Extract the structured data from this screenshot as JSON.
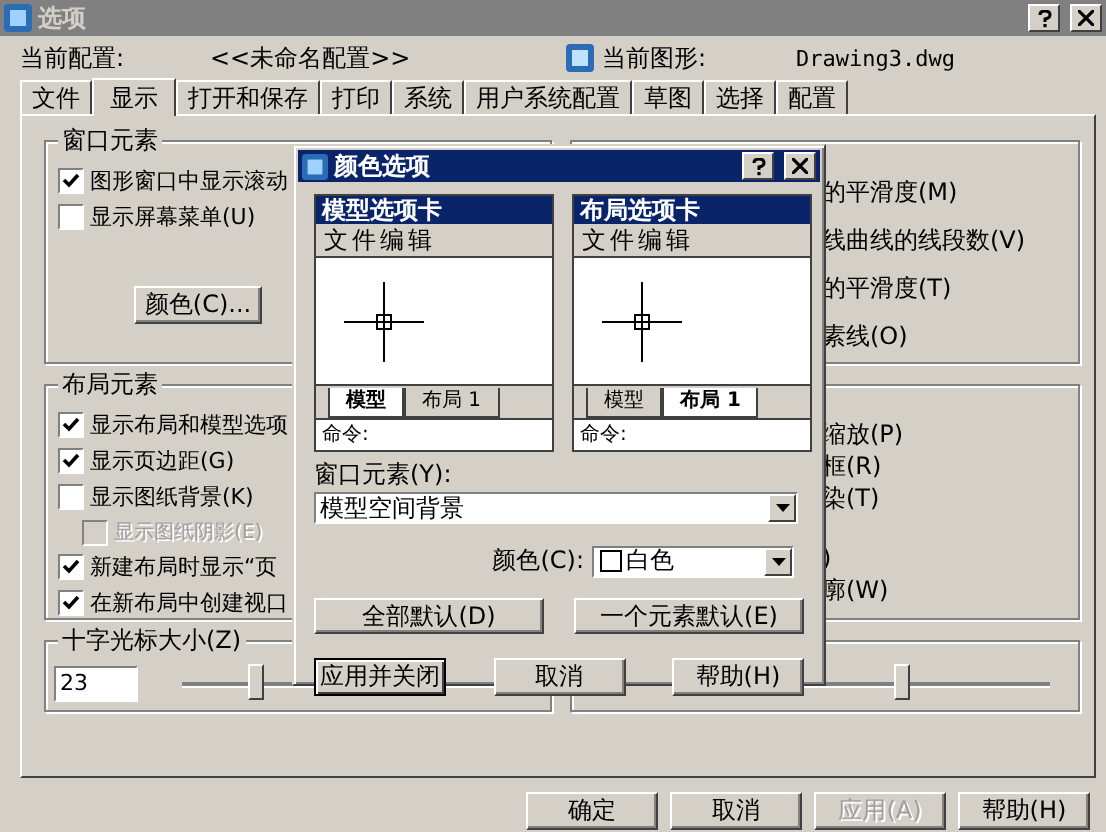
{
  "window": {
    "title": "选项"
  },
  "profile": {
    "label": "当前配置:",
    "value": "<<未命名配置>>"
  },
  "drawing": {
    "label": "当前图形:",
    "value": "Drawing3.dwg"
  },
  "tabs": [
    {
      "label": "文件",
      "selected": false
    },
    {
      "label": "显示",
      "selected": true
    },
    {
      "label": "打开和保存",
      "selected": false
    },
    {
      "label": "打印",
      "selected": false
    },
    {
      "label": "系统",
      "selected": false
    },
    {
      "label": "用户系统配置",
      "selected": false
    },
    {
      "label": "草图",
      "selected": false
    },
    {
      "label": "选择",
      "selected": false
    },
    {
      "label": "配置",
      "selected": false
    }
  ],
  "window_elements": {
    "title": "窗口元素",
    "checkboxes": [
      {
        "label": "图形窗口中显示滚动",
        "checked": true
      },
      {
        "label": "显示屏幕菜单(U)",
        "checked": false
      }
    ],
    "color_button": "颜色(C)..."
  },
  "display_resolution": {
    "items": [
      "的平滑度(M)",
      "线曲线的线段数(V)",
      "的平滑度(T)",
      "素线(O)"
    ]
  },
  "layout_elements": {
    "title": "布局元素",
    "checkboxes": [
      {
        "label": "显示布局和模型选项",
        "checked": true,
        "disabled": false
      },
      {
        "label": "显示页边距(G)",
        "checked": true,
        "disabled": false
      },
      {
        "label": "显示图纸背景(K)",
        "checked": false,
        "disabled": false,
        "children": [
          {
            "label": "显示图纸阴影(E)",
            "checked": false,
            "disabled": true
          }
        ]
      },
      {
        "label": "新建布局时显示“页",
        "checked": true,
        "disabled": false
      },
      {
        "label": "在新布局中创建视口",
        "checked": true,
        "disabled": false
      }
    ]
  },
  "display_performance": {
    "items": [
      "缩放(P)",
      "框(R)",
      "染(T)",
      ")",
      "廓(W)"
    ]
  },
  "crosshair": {
    "title": "十字光标大小(Z)",
    "value": "23",
    "level": 0.22
  },
  "fade_control": {
    "level": 0.57
  },
  "buttons": [
    {
      "label": "确定",
      "disabled": false
    },
    {
      "label": "取消",
      "disabled": false
    },
    {
      "label": "应用(A)",
      "disabled": true
    },
    {
      "label": "帮助(H)",
      "disabled": false
    }
  ],
  "color_dialog": {
    "title": "颜色选项",
    "previews": [
      {
        "title": "模型选项卡",
        "menu": "文件编辑",
        "tabs": [
          {
            "label": "模型",
            "selected": true
          },
          {
            "label": "布局 1",
            "selected": false
          }
        ],
        "command": "命令:"
      },
      {
        "title": "布局选项卡",
        "menu": "文件编辑",
        "tabs": [
          {
            "label": "模型",
            "selected": false
          },
          {
            "label": "布局 1",
            "selected": true
          }
        ],
        "command": "命令:"
      }
    ],
    "element_label": "窗口元素(Y):",
    "element_value": "模型空间背景",
    "color_label": "颜色(C):",
    "color_value": "白色",
    "default_buttons": [
      "全部默认(D)",
      "一个元素默认(E)"
    ],
    "buttons": [
      {
        "label": "应用并关闭",
        "focused": true
      },
      {
        "label": "取消",
        "focused": false
      },
      {
        "label": "帮助(H)",
        "focused": false
      }
    ]
  }
}
